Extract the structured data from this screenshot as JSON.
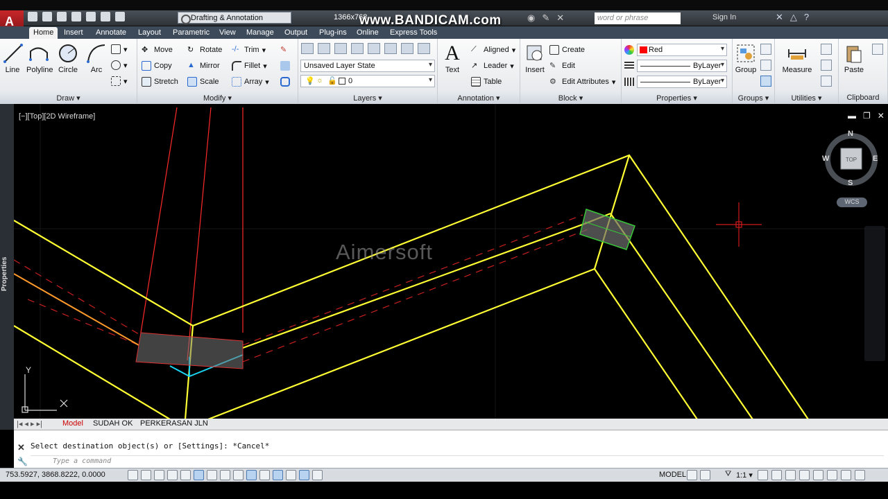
{
  "title_bar": {
    "workspace": "Drafting & Annotation",
    "resolution": "1366x768",
    "recorder_watermark": "www.BANDICAM.com",
    "search_placeholder": "word or phrase",
    "signin": "Sign In"
  },
  "tabs": [
    "Home",
    "Insert",
    "Annotate",
    "Layout",
    "Parametric",
    "View",
    "Manage",
    "Output",
    "Plug-ins",
    "Online",
    "Express Tools"
  ],
  "ribbon": {
    "draw": {
      "title": "Draw ▾",
      "line": "Line",
      "polyline": "Polyline",
      "circle": "Circle",
      "arc": "Arc"
    },
    "modify": {
      "title": "Modify ▾",
      "move": "Move",
      "rotate": "Rotate",
      "trim": "Trim",
      "copy": "Copy",
      "mirror": "Mirror",
      "fillet": "Fillet",
      "stretch": "Stretch",
      "scale": "Scale",
      "array": "Array"
    },
    "layers": {
      "title": "Layers ▾",
      "layer_state": "Unsaved Layer State",
      "current_layer": "0"
    },
    "annotation": {
      "title": "Annotation ▾",
      "text": "Text",
      "aligned": "Aligned",
      "leader": "Leader",
      "table": "Table"
    },
    "block": {
      "title": "Block ▾",
      "insert": "Insert",
      "create": "Create",
      "edit": "Edit",
      "edit_attributes": "Edit Attributes"
    },
    "properties": {
      "title": "Properties ▾",
      "color": "Red",
      "linetype": "ByLayer",
      "lineweight": "ByLayer"
    },
    "groups": {
      "title": "Groups ▾",
      "group": "Group"
    },
    "utilities": {
      "title": "Utilities ▾",
      "measure": "Measure"
    },
    "clipboard": {
      "title": "Clipboard",
      "paste": "Paste"
    }
  },
  "viewport": {
    "label": "[−][Top][2D Wireframe]",
    "viewcube": {
      "n": "N",
      "s": "S",
      "e": "E",
      "w": "W",
      "top": "TOP",
      "wcs": "WCS"
    },
    "watermark": "Aimersoft",
    "ucs_y": "Y"
  },
  "side_palette": "Properties",
  "layout_tabs": [
    "Model",
    "SUDAH OK",
    "PERKERASAN JLN"
  ],
  "command": {
    "history": "Select destination object(s) or [Settings]: *Cancel*",
    "input_placeholder": "Type a command"
  },
  "status": {
    "coords": "753.5927, 3868.8222, 0.0000",
    "model": "MODEL",
    "scale": "1:1 ▾"
  },
  "colors": {
    "road_edge": "#ffff33",
    "red_line": "#ff2a2a",
    "cyan": "#19d3f0",
    "selection_green": "#38c838",
    "orange": "#ff9a2a"
  }
}
